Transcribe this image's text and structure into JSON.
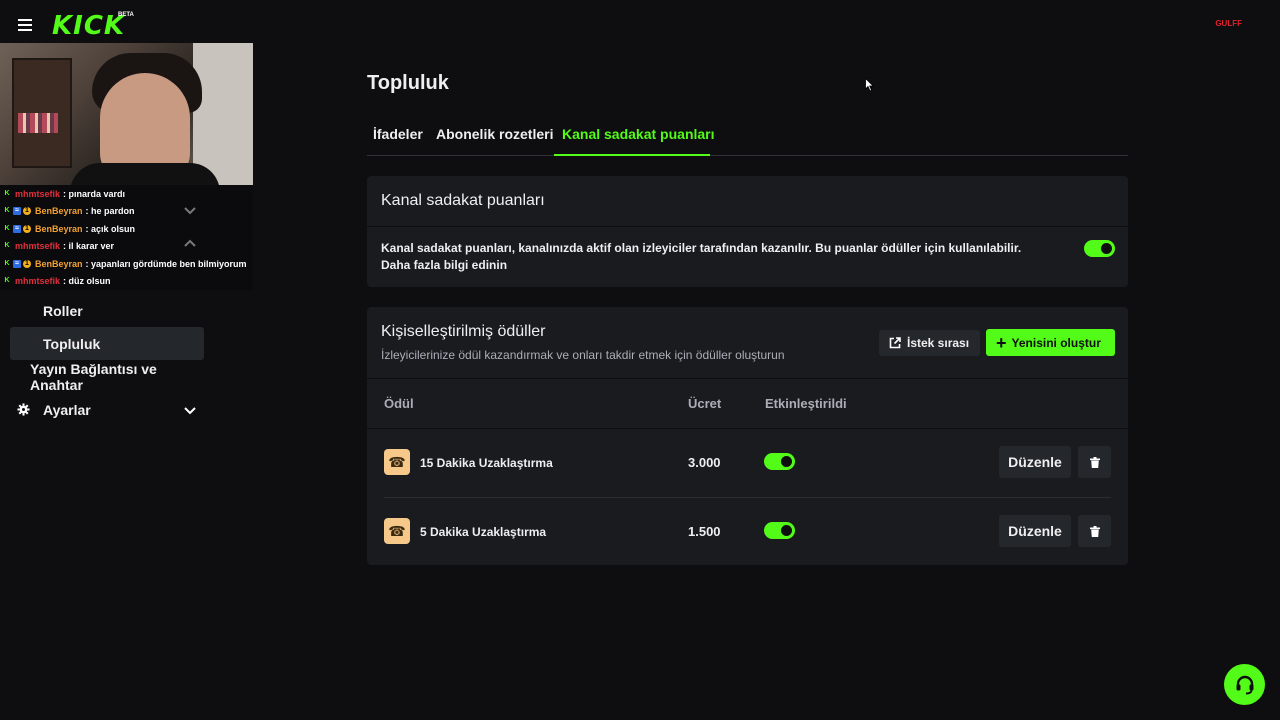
{
  "header": {
    "logo": "KICK",
    "logo_badge": "BETA",
    "user": "GULFF"
  },
  "chat": [
    {
      "user": "mhmtsefik",
      "user_color": "#e0303c",
      "text": ": pınarda vardı",
      "badges": [
        "kick"
      ]
    },
    {
      "user": "BenBeyran",
      "user_color": "#f2a233",
      "text": ": he pardon",
      "badges": [
        "kick",
        "blue",
        "gold"
      ]
    },
    {
      "user": "BenBeyran",
      "user_color": "#f2a233",
      "text": ": açık olsun",
      "badges": [
        "kick",
        "blue",
        "gold"
      ]
    },
    {
      "user": "mhmtsefik",
      "user_color": "#e0303c",
      "text": ": il karar ver",
      "badges": [
        "kick"
      ]
    },
    {
      "user": "BenBeyran",
      "user_color": "#f2a233",
      "text": ": yapanları gördümde ben bilmiyorum",
      "badges": [
        "kick",
        "blue",
        "gold"
      ]
    },
    {
      "user": "mhmtsefik",
      "user_color": "#e0303c",
      "text": ": düz olsun",
      "badges": [
        "kick"
      ]
    }
  ],
  "sidebar": {
    "items": [
      {
        "label": "Roller"
      },
      {
        "label": "Topluluk",
        "active": true
      },
      {
        "label": "Yayın Bağlantısı ve Anahtar"
      },
      {
        "label": "Ayarlar"
      }
    ]
  },
  "page": {
    "title": "Topluluk",
    "tabs": [
      {
        "label": "İfadeler"
      },
      {
        "label": "Abonelik rozetleri"
      },
      {
        "label": "Kanal sadakat puanları",
        "active": true
      }
    ]
  },
  "loyalty": {
    "title": "Kanal sadakat puanları",
    "description": "Kanal sadakat puanları, kanalınızda aktif olan izleyiciler tarafından kazanılır. Bu puanlar ödüller için kullanılabilir.",
    "link": "Daha fazla bilgi edinin",
    "enabled": true
  },
  "rewards": {
    "title": "Kişiselleştirilmiş ödüller",
    "subtitle": "İzleyicilerinize ödül kazandırmak ve onları takdir etmek için ödüller oluşturun",
    "queue_button": "İstek sırası",
    "new_button": "Yenisini oluştur",
    "columns": {
      "reward": "Ödül",
      "cost": "Ücret",
      "enabled": "Etkinleştirildi"
    },
    "rows": [
      {
        "icon": "phone-icon",
        "name": "15 Dakika Uzaklaştırma",
        "cost": "3.000",
        "enabled": true,
        "edit_label": "Düzenle"
      },
      {
        "icon": "phone-icon",
        "name": "5 Dakika Uzaklaştırma",
        "cost": "1.500",
        "enabled": true,
        "edit_label": "Düzenle"
      }
    ]
  },
  "colors": {
    "accent": "#53fc18",
    "background": "#0e0e10",
    "card": "#191b1f"
  }
}
